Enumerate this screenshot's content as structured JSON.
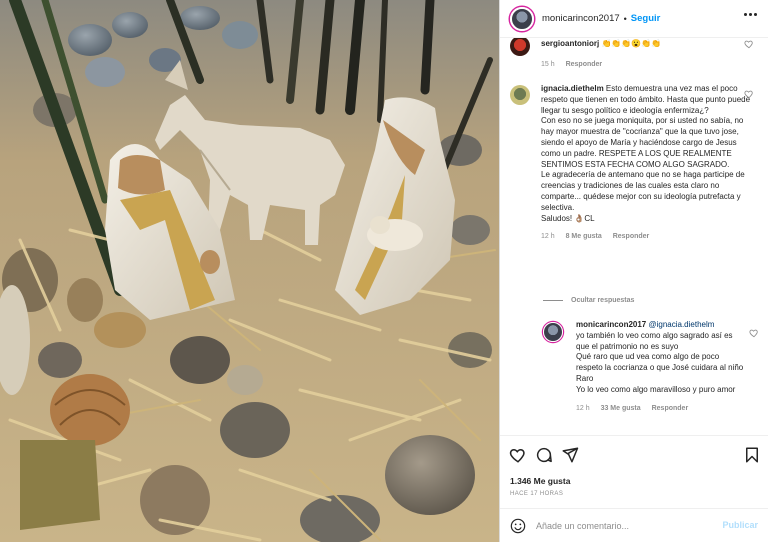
{
  "post": {
    "author": "monicarincon2017",
    "separator": "•",
    "follow_label": "Seguir",
    "more_icon": "more-horizontal-icon",
    "photo_description": "nativity-figurines-on-bamboo-leaves"
  },
  "comments": [
    {
      "username": "sergioantoniorj",
      "text": "👏👏👏😮👏👏",
      "time": "15 h",
      "reply_label": "Responder"
    },
    {
      "username": "ignacia.diethelm",
      "text": "Esto demuestra una vez mas el poco respeto que tienen en todo ámbito. Hasta que punto puede llegar tu sesgo político e ideología enfermiza¿?\nCon eso no se juega moniquita, por si usted no sabía, no hay mayor muestra de \"cocrianza\" que la que tuvo jose, siendo el apoyo de María y haciéndose cargo de Jesus como un padre. RESPETE A LOS QUE REALMENTE SENTIMOS ESTA FECHA COMO ALGO SAGRADO.\nLe agradecería de antemano que no se haga participe de creencias y tradiciones de las cuales esta claro no comparte... quédese mejor con su ideología putrefacta y selectiva.\nSaludos! 👌🏽CL",
      "time": "12 h",
      "likes": "8 Me gusta",
      "reply_label": "Responder"
    }
  ],
  "hide_replies_label": "Ocultar respuestas",
  "reply": {
    "username": "monicarincon2017",
    "mention": "@ignacia.diethelm",
    "text": "yo también lo veo como algo sagrado así es que el patrimonio no es suyo\nQué raro que ud vea como algo de poco respeto la cocrianza o que José cuidara al niño Raro\nYo lo veo como algo maravilloso y puro amor",
    "time": "12 h",
    "likes": "33 Me gusta",
    "reply_label": "Responder"
  },
  "actions": {
    "like_icon": "heart-icon",
    "comment_icon": "comment-icon",
    "share_icon": "paper-plane-icon",
    "save_icon": "bookmark-icon",
    "likes_label": "1.346 Me gusta",
    "time_label": "HACE 17 HORAS"
  },
  "add_comment": {
    "placeholder": "Añade un comentario...",
    "publish_label": "Publicar"
  },
  "colors": {
    "accent": "#0095f6",
    "publish_disabled": "#b2dffc",
    "secondary_text": "#8e8e8e",
    "border": "#dbdbdb"
  }
}
